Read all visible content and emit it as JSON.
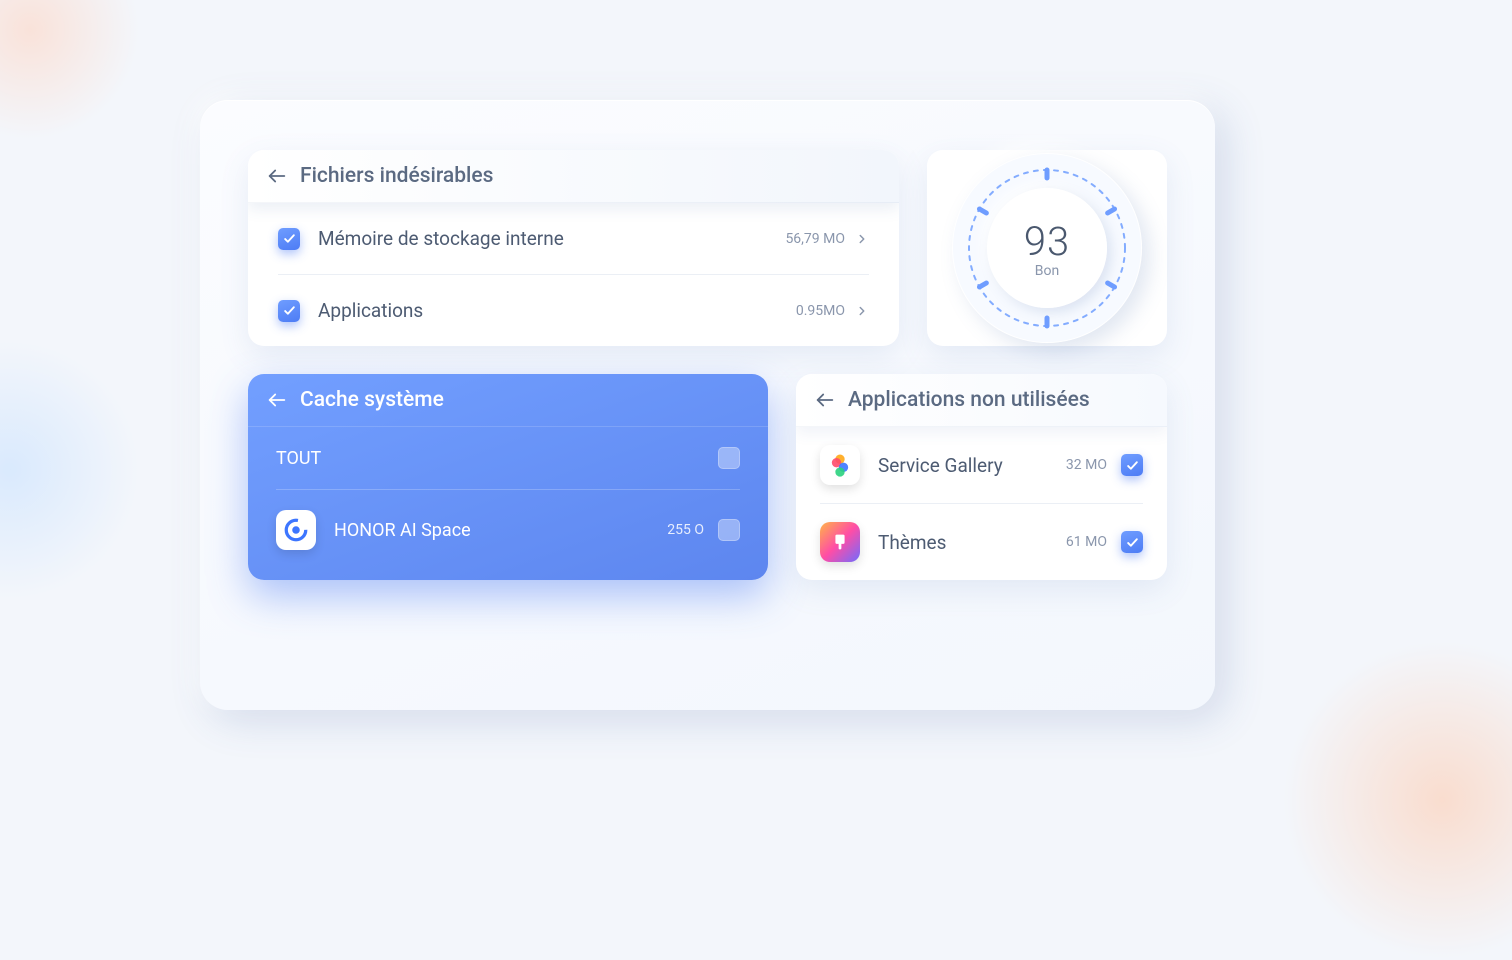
{
  "undesirable": {
    "title": "Fichiers indésirables",
    "items": [
      {
        "label": "Mémoire de stockage interne",
        "size": "56,79 MO"
      },
      {
        "label": "Applications",
        "size": "0.95MO"
      }
    ]
  },
  "score": {
    "value": "93",
    "label": "Bon"
  },
  "cache": {
    "title": "Cache système",
    "items": [
      {
        "label": "TOUT",
        "size": ""
      },
      {
        "label": "HONOR AI Space",
        "size": "255 O"
      }
    ]
  },
  "unused": {
    "title": "Applications non utilisées",
    "items": [
      {
        "label": "Service Gallery",
        "size": "32 MO"
      },
      {
        "label": "Thèmes",
        "size": "61 MO"
      }
    ]
  },
  "colors": {
    "accent": "#5d86ef",
    "text": "#4d5b72",
    "subtext": "#8a96ac"
  }
}
